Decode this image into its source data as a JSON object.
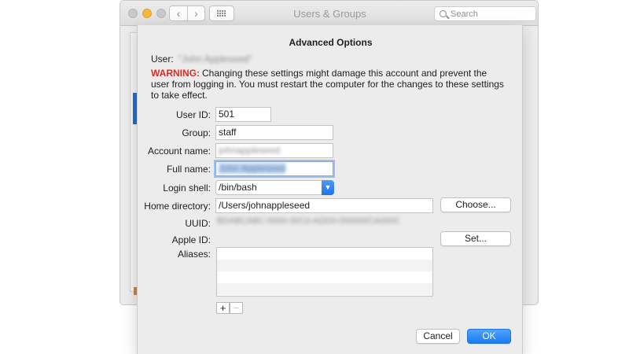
{
  "window": {
    "title": "Users & Groups",
    "search_placeholder": "Search",
    "nav_back_icon": "chevron-left-icon",
    "nav_forward_icon": "chevron-right-icon",
    "grid_icon": "show-all-grid-icon"
  },
  "dialog": {
    "title": "Advanced Options",
    "user_label": "User:",
    "user_value": "\"John Appleseed\"",
    "warning_label": "WARNING:",
    "warning_text": "Changing these settings might damage this account and prevent the user from logging in. You must restart the computer for the changes to these settings to take effect.",
    "fields": {
      "user_id": {
        "label": "User ID:",
        "value": "501"
      },
      "group": {
        "label": "Group:",
        "value": "staff"
      },
      "account_name": {
        "label": "Account name:",
        "value": "johnappleseed"
      },
      "full_name": {
        "label": "Full name:",
        "value": "John Appleseed"
      },
      "login_shell": {
        "label": "Login shell:",
        "value": "/bin/bash"
      },
      "home_directory": {
        "label": "Home directory:",
        "value": "/Users/johnappleseed"
      },
      "uuid": {
        "label": "UUID:",
        "value": "BDABCABC-0000-00C0-ADD0-000000CA000C0"
      },
      "apple_id": {
        "label": "Apple ID:"
      },
      "aliases": {
        "label": "Aliases:"
      }
    },
    "buttons": {
      "choose": "Choose...",
      "set": "Set...",
      "add": "+",
      "remove": "−",
      "cancel": "Cancel",
      "ok": "OK"
    }
  },
  "colors": {
    "accent": "#1c7bf3",
    "warning": "#e02a1d",
    "sheet_bg": "#ececec"
  }
}
